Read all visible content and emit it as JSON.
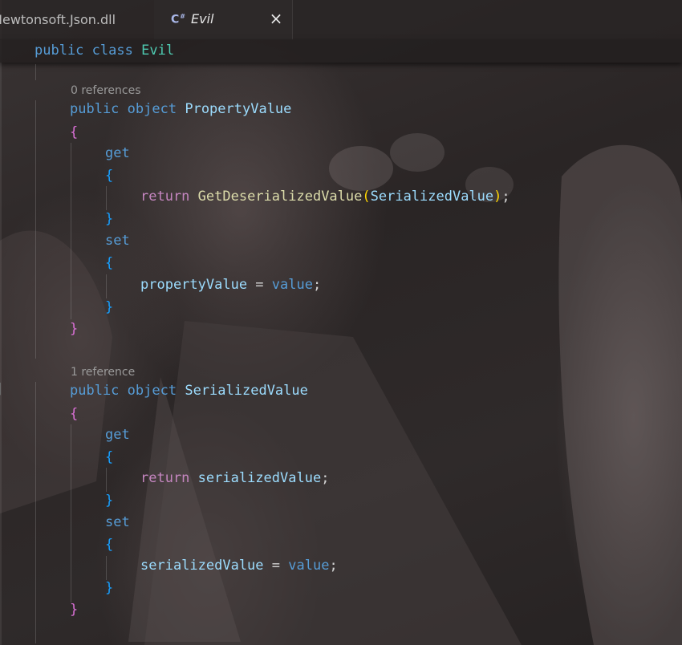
{
  "tabs": {
    "inactive_label": "Newtonsoft.Json.dll",
    "active_label": "Evil",
    "active_icon": "csharp-file-icon",
    "close_symbol": "×"
  },
  "code": {
    "class_decl": {
      "kw1": "public",
      "kw2": "class",
      "name": "Evil"
    },
    "property1": {
      "codelens": "0 references",
      "kw1": "public",
      "kw2": "object",
      "name": "PropertyValue",
      "open": "{",
      "close": "}",
      "get": "get",
      "get_open": "{",
      "get_close": "}",
      "get_body": {
        "ret": "return",
        "method": "GetDeserializedValue",
        "paren_open": "(",
        "arg": "SerializedValue",
        "paren_close": ")",
        "semi": ";"
      },
      "set": "set",
      "set_open": "{",
      "set_close": "}",
      "set_body": {
        "lhs": "propertyValue",
        "op": " = ",
        "rhs": "value",
        "semi": ";"
      }
    },
    "property2": {
      "codelens": "1 reference",
      "kw1": "public",
      "kw2": "object",
      "name": "SerializedValue",
      "open": "{",
      "close": "}",
      "get": "get",
      "get_open": "{",
      "get_close": "}",
      "get_body": {
        "ret": "return",
        "field": "serializedValue",
        "semi": ";"
      },
      "set": "set",
      "set_open": "{",
      "set_close": "}",
      "set_body": {
        "lhs": "serializedValue",
        "op": " = ",
        "rhs": "value",
        "semi": ";"
      }
    }
  },
  "colors": {
    "keyword": "#569cd6",
    "type": "#4ec9b0",
    "property": "#9cdcfe",
    "method": "#dcdcaa",
    "control": "#c586c0",
    "bracket_level1": "#da70d6",
    "bracket_level2": "#179fff",
    "bracket_level3": "#ffd700"
  }
}
